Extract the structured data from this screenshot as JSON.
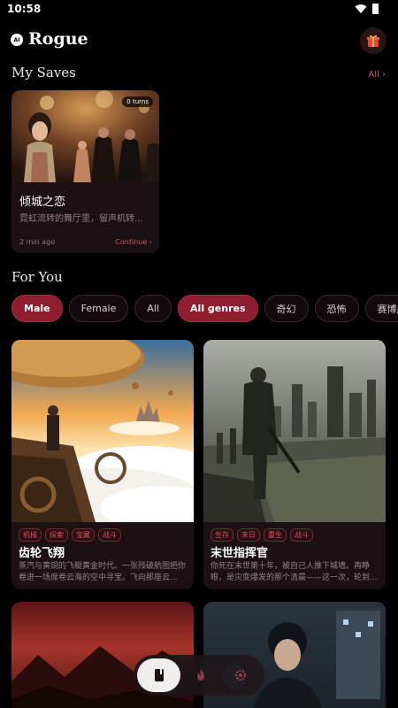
{
  "status_bar": {
    "time": "10:58"
  },
  "header": {
    "logo_badge": "AI",
    "title": "Rogue"
  },
  "saves": {
    "section_title": "My Saves",
    "all_link": "All ›",
    "card": {
      "turns": "0 turns",
      "title": "倾城之恋",
      "description": "霓虹流转的舞厅里，留声机转...",
      "time": "2 min ago",
      "continue": "Continue ›"
    }
  },
  "for_you": {
    "section_title": "For You",
    "filters": [
      "Male",
      "Female",
      "All",
      "All genres",
      "奇幻",
      "恐怖",
      "赛博朋克"
    ],
    "active_filters": [
      "Male",
      "All genres"
    ]
  },
  "stories": [
    {
      "tags": [
        "机械",
        "探索",
        "宝藏",
        "战斗"
      ],
      "title": "齿轮飞翔",
      "description": "蒸汽与黄铜的飞艇黄金时代。一张残破航图把你卷进一场席卷云海的空中寻宝。飞向那座云..."
    },
    {
      "tags": [
        "生存",
        "末日",
        "重生",
        "战斗"
      ],
      "title": "末世指挥官",
      "description": "你死在末世第十年，被自己人推下城墙。再睁眼，是灾变爆发的那个清晨——这一次，轮到..."
    }
  ],
  "icons": {
    "wifi": "wifi-icon",
    "battery": "battery-icon",
    "gift": "gift-icon",
    "library": "book-icon",
    "trending": "flame-icon",
    "settings": "gear-icon"
  },
  "colors": {
    "accent": "#8e1d2f",
    "link": "#c65b63",
    "card_bg": "#1b1115"
  }
}
